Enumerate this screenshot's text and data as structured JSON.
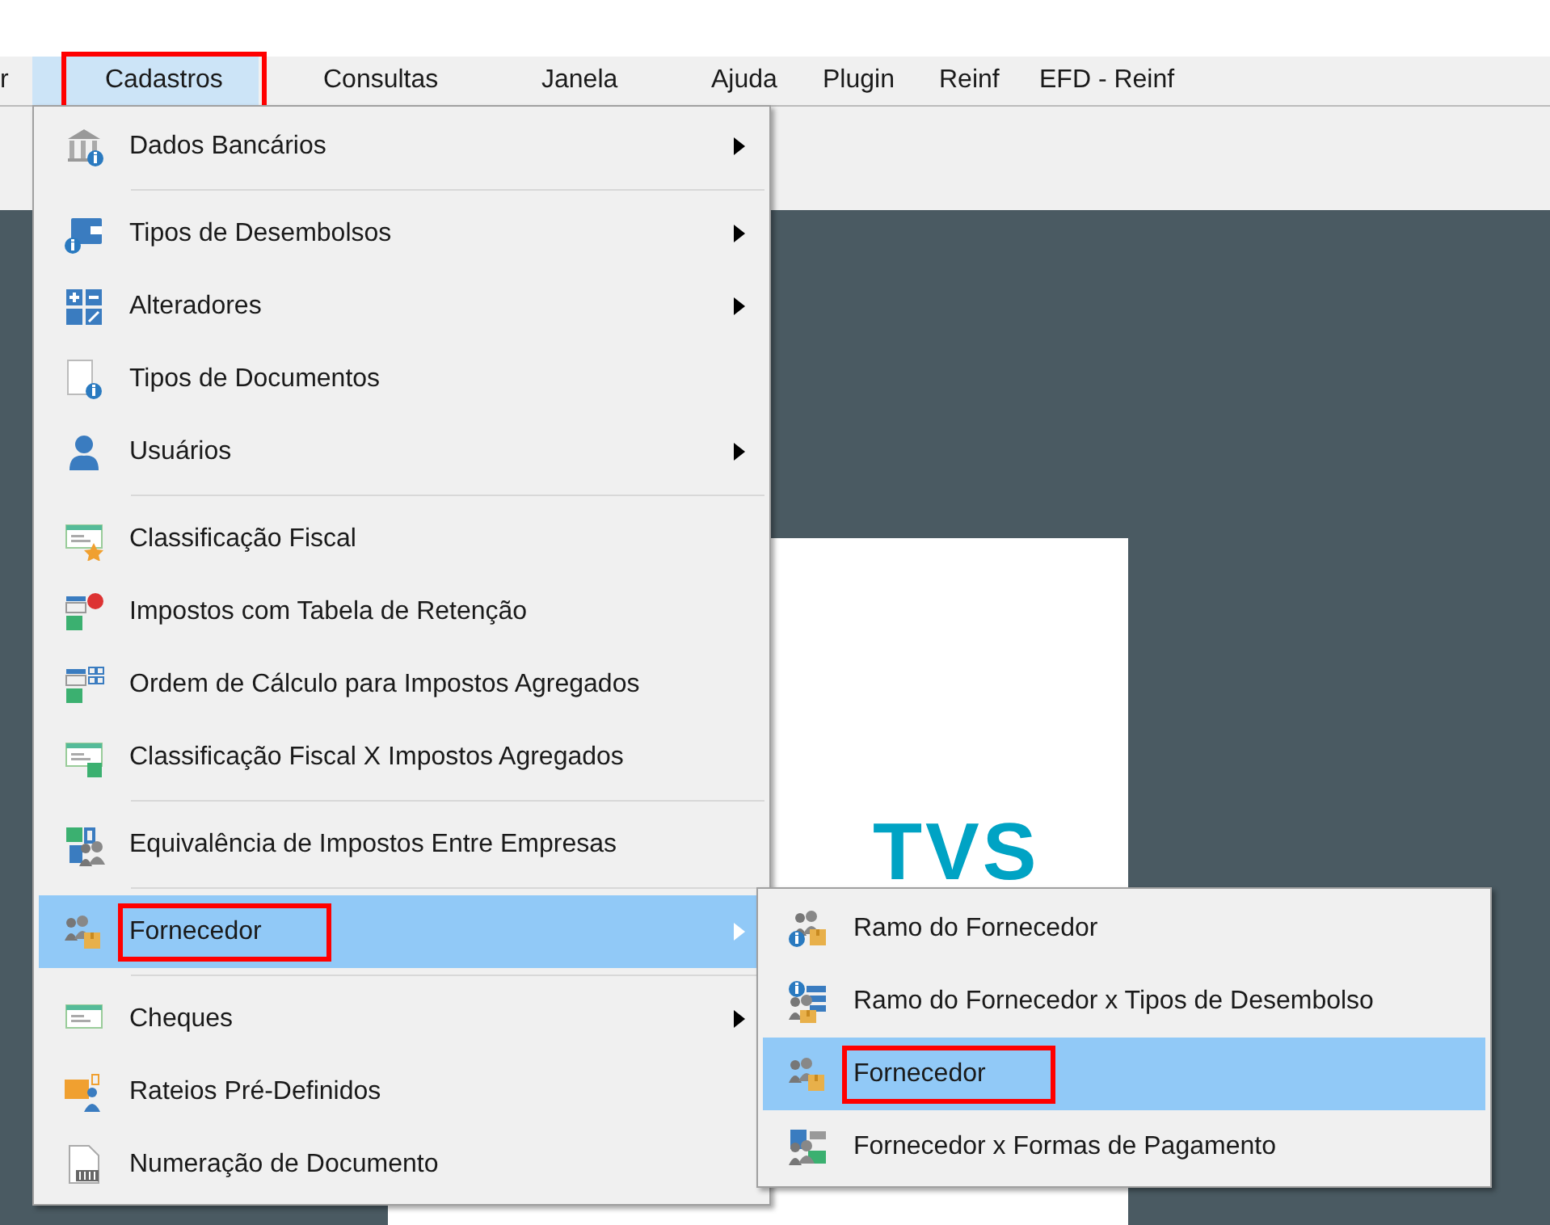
{
  "menubar": {
    "items": [
      {
        "label": "r",
        "selected": false,
        "annotated": false
      },
      {
        "label": "Cadastros",
        "selected": true,
        "annotated": true
      },
      {
        "label": "Consultas",
        "selected": false,
        "annotated": false
      },
      {
        "label": "Janela",
        "selected": false,
        "annotated": false
      },
      {
        "label": "Ajuda",
        "selected": false,
        "annotated": false
      },
      {
        "label": "Plugin",
        "selected": false,
        "annotated": false
      },
      {
        "label": "Reinf",
        "selected": false,
        "annotated": false
      },
      {
        "label": "EFD - Reinf",
        "selected": false,
        "annotated": false
      }
    ]
  },
  "document": {
    "logo_text": "TVS"
  },
  "menu": {
    "items": [
      {
        "kind": "item",
        "label": "Dados Bancários",
        "has_submenu": true,
        "selected": false,
        "annotated": false
      },
      {
        "kind": "separator"
      },
      {
        "kind": "item",
        "label": "Tipos de Desembolsos",
        "has_submenu": true,
        "selected": false,
        "annotated": false
      },
      {
        "kind": "item",
        "label": "Alteradores",
        "has_submenu": true,
        "selected": false,
        "annotated": false
      },
      {
        "kind": "item",
        "label": "Tipos de Documentos",
        "has_submenu": false,
        "selected": false,
        "annotated": false
      },
      {
        "kind": "item",
        "label": "Usuários",
        "has_submenu": true,
        "selected": false,
        "annotated": false
      },
      {
        "kind": "separator"
      },
      {
        "kind": "item",
        "label": "Classificação Fiscal",
        "has_submenu": false,
        "selected": false,
        "annotated": false
      },
      {
        "kind": "item",
        "label": "Impostos com Tabela de Retenção",
        "has_submenu": false,
        "selected": false,
        "annotated": false
      },
      {
        "kind": "item",
        "label": "Ordem de Cálculo para Impostos Agregados",
        "has_submenu": false,
        "selected": false,
        "annotated": false
      },
      {
        "kind": "item",
        "label": "Classificação Fiscal X Impostos Agregados",
        "has_submenu": false,
        "selected": false,
        "annotated": false
      },
      {
        "kind": "separator"
      },
      {
        "kind": "item",
        "label": "Equivalência de Impostos Entre Empresas",
        "has_submenu": false,
        "selected": false,
        "annotated": false
      },
      {
        "kind": "separator"
      },
      {
        "kind": "item",
        "label": "Fornecedor",
        "has_submenu": true,
        "selected": true,
        "annotated": true
      },
      {
        "kind": "separator"
      },
      {
        "kind": "item",
        "label": "Cheques",
        "has_submenu": true,
        "selected": false,
        "annotated": false
      },
      {
        "kind": "item",
        "label": "Rateios Pré-Definidos",
        "has_submenu": false,
        "selected": false,
        "annotated": false
      },
      {
        "kind": "item",
        "label": "Numeração de Documento",
        "has_submenu": false,
        "selected": false,
        "annotated": false
      }
    ]
  },
  "submenu": {
    "items": [
      {
        "kind": "item",
        "label": "Ramo do Fornecedor",
        "has_submenu": false,
        "selected": false,
        "annotated": false
      },
      {
        "kind": "item",
        "label": "Ramo do Fornecedor x Tipos de Desembolso",
        "has_submenu": false,
        "selected": false,
        "annotated": false
      },
      {
        "kind": "item",
        "label": "Fornecedor",
        "has_submenu": false,
        "selected": true,
        "annotated": true
      },
      {
        "kind": "item",
        "label": "Fornecedor x Formas de Pagamento",
        "has_submenu": false,
        "selected": false,
        "annotated": false
      }
    ]
  }
}
